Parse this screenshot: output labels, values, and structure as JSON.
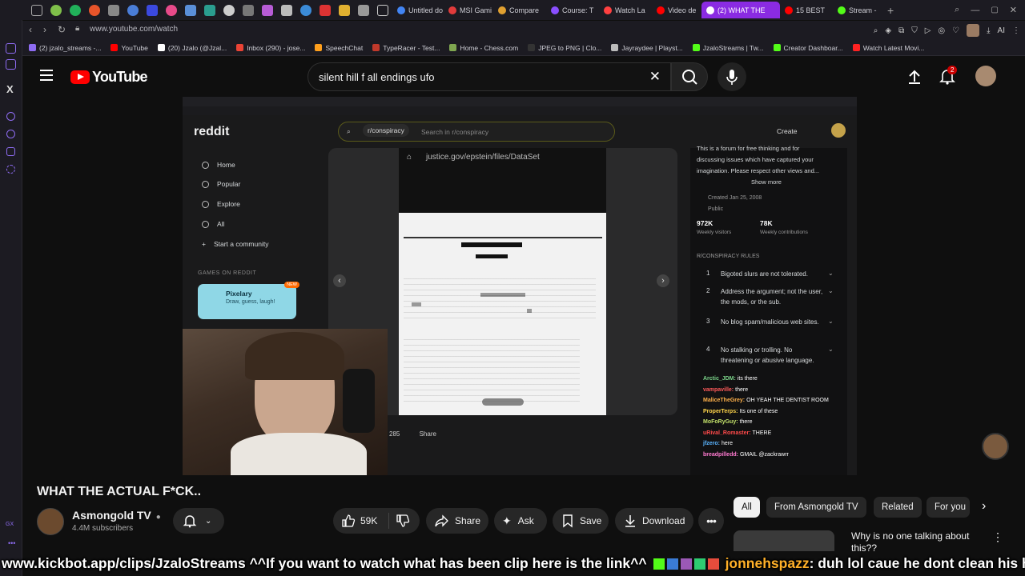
{
  "browser": {
    "tabs": [
      {
        "label": "Untitled do",
        "color": "#4285f4"
      },
      {
        "label": "MSI Gami",
        "color": "#e23b3b"
      },
      {
        "label": "Compare",
        "color": "#e0a030"
      },
      {
        "label": "Course: T",
        "color": "#8a4fff"
      },
      {
        "label": "Watch La",
        "color": "#ff4040"
      },
      {
        "label": "Video de",
        "color": "#ff0000"
      },
      {
        "label": "(2) WHAT THE",
        "color": "#ffffff",
        "active": true
      },
      {
        "label": "15 BEST",
        "color": "#ff0000"
      },
      {
        "label": "Stream -",
        "color": "#53fc18"
      }
    ],
    "url": "www.youtube.com/watch",
    "bookmarks": [
      {
        "label": "(2) jzalo_streams -...",
        "color": "#8e6cf2"
      },
      {
        "label": "YouTube",
        "color": "#ff0000"
      },
      {
        "label": "(20) Jzalo (@Jzal...",
        "color": "#ffffff"
      },
      {
        "label": "Inbox (290) - jose...",
        "color": "#ea4335"
      },
      {
        "label": "SpeechChat",
        "color": "#ff9f1c"
      },
      {
        "label": "TypeRacer - Test...",
        "color": "#c0392b"
      },
      {
        "label": "Home - Chess.com",
        "color": "#7fa650"
      },
      {
        "label": "JPEG to PNG | Clo...",
        "color": "#333333"
      },
      {
        "label": "Jayraydee | Playst...",
        "color": "#bbbbbb"
      },
      {
        "label": "JzaloStreams | Tw...",
        "color": "#53fc18"
      },
      {
        "label": "Creator Dashboar...",
        "color": "#53fc18"
      },
      {
        "label": "Watch Latest Movi...",
        "color": "#ff2222"
      }
    ],
    "ai_label": "AI"
  },
  "youtube": {
    "logo_text": "YouTube",
    "search_query": "silent hill f all endings ufo",
    "notification_count": "2"
  },
  "video_content": {
    "reddit": {
      "logo": "reddit",
      "subreddit_chip": "r/conspiracy",
      "search_placeholder": "Search in r/conspiracy",
      "create_label": "Create",
      "nav": [
        "Home",
        "Popular",
        "Explore",
        "All",
        "Start a community"
      ],
      "games_heading": "GAMES ON REDDIT",
      "game_title": "Pixelary",
      "game_desc": "Draw, guess, laugh!",
      "game_badge": "NEW",
      "phone_url": "justice.gov/epstein/files/DataSet",
      "about_text_1": "This is a forum for free thinking and for",
      "about_text_2": "discussing issues which have captured your",
      "about_text_3": "imagination. Please respect other views and...",
      "show_more": "Show more",
      "created": "Created Jan 25, 2008",
      "visibility": "Public",
      "weekly_visitors_value": "972K",
      "weekly_visitors_label": "Weekly visitors",
      "weekly_contrib_value": "78K",
      "weekly_contrib_label": "Weekly contributions",
      "rules_heading": "R/CONSPIRACY RULES",
      "rules": [
        {
          "n": "1",
          "text": "Bigoted slurs are not tolerated."
        },
        {
          "n": "2",
          "text": "Address the argument; not the user, the mods, or the sub."
        },
        {
          "n": "3",
          "text": "No blog spam/malicious web sites."
        },
        {
          "n": "4",
          "text": "No stalking or trolling. No threatening or abusive language."
        }
      ],
      "post_votes": "285",
      "post_share": "Share"
    },
    "chat": [
      {
        "user": "Arctic_JDM:",
        "msg": "its there",
        "color": "#7bd389"
      },
      {
        "user": "vampaville:",
        "msg": "there",
        "color": "#ff5a5a"
      },
      {
        "user": "MaliceTheGrey:",
        "msg": "OH YEAH THE DENTIST ROOM",
        "color": "#ffb14a"
      },
      {
        "user": "ProperTerps:",
        "msg": "Its one of these",
        "color": "#ffd54a"
      },
      {
        "user": "MoFoRyGuy:",
        "msg": "there",
        "color": "#c2e06a"
      },
      {
        "user": "uRival_Romaster:",
        "msg": "THERE",
        "color": "#ff4a4a"
      },
      {
        "user": "jfzero:",
        "msg": "here",
        "color": "#5ab4ff"
      },
      {
        "user": "breadpilledd:",
        "msg": "GMAIL @zackrawrr",
        "color": "#ff7ad0"
      }
    ]
  },
  "video": {
    "title": "WHAT THE ACTUAL F*CK..",
    "channel": "Asmongold TV",
    "subscribers": "4.4M subscribers",
    "likes": "59K",
    "share_label": "Share",
    "ask_label": "Ask",
    "save_label": "Save",
    "download_label": "Download"
  },
  "related": {
    "chips": [
      "All",
      "From Asmongold TV",
      "Related",
      "For you"
    ],
    "first_title": "Why is no one talking about this??"
  },
  "ticker": {
    "text": "www.kickbot.app/clips/JzaloStreams ^^If you want to watch what has been clip here is the link^^",
    "user": "jonnehspazz",
    "msg": ": duh lol caue he dont clean his house"
  },
  "colors": {
    "yt_red": "#ff0000",
    "bg": "#0f0f0f",
    "opera_accent": "#8a2be2"
  }
}
